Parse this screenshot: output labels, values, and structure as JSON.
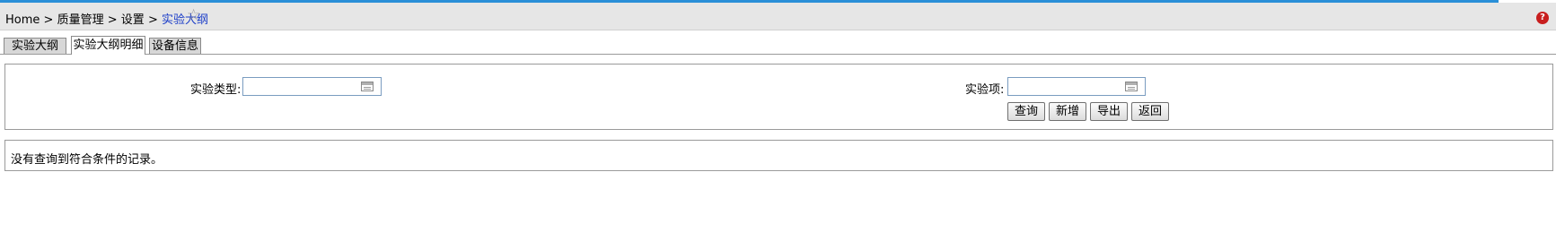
{
  "breadcrumb": {
    "items": [
      "Home",
      "质量管理",
      "设置",
      "实验大纲"
    ],
    "separator": ">"
  },
  "icons": {
    "favorite": "star-outline-icon",
    "help": "help-icon",
    "help_glyph": "?"
  },
  "tabs": [
    {
      "label": "实验大纲",
      "active": false
    },
    {
      "label": "实验大纲明细",
      "active": true
    },
    {
      "label": "设备信息",
      "active": false
    }
  ],
  "filters": {
    "experiment_type": {
      "label": "实验类型:",
      "value": ""
    },
    "experiment_item": {
      "label": "实验项:",
      "value": ""
    }
  },
  "actions": {
    "query": "查询",
    "add": "新增",
    "export": "导出",
    "back": "返回"
  },
  "result": {
    "empty_message": "没有查询到符合条件的记录。"
  },
  "colors": {
    "accent": "#2a8fd8",
    "current_crumb": "#1a3cc8",
    "help": "#c81e1e"
  }
}
